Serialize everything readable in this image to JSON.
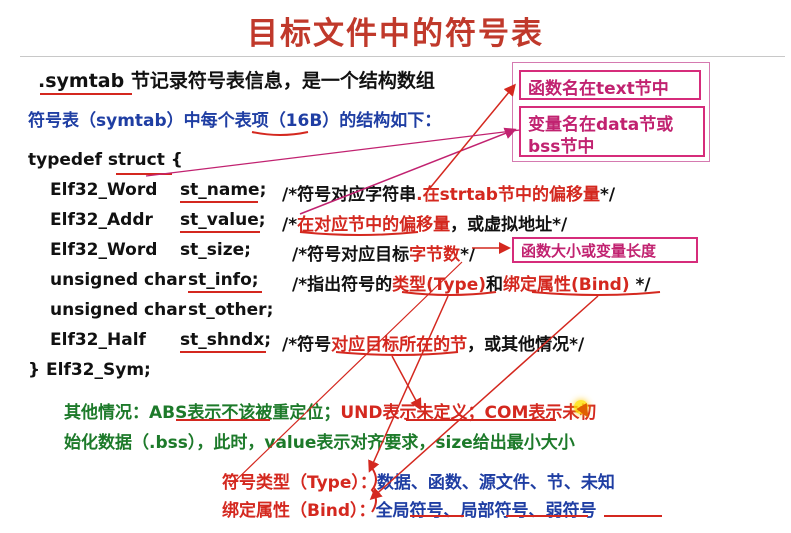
{
  "title": "目标文件中的符号表",
  "intro": {
    "symtab": ".symtab",
    "rest": " 节记录符号表信息，是一个结构数组"
  },
  "entry_desc": {
    "prefix": "符号表（symtab）中每",
    "mid": "个表项",
    "suffix": "（16B）的结构如下："
  },
  "notes": {
    "func_in_text": "函数名在text节中",
    "var_in_data": "变量名在data节或",
    "var_in_bss": "bss节中",
    "size_note": "函数大小或变量长度"
  },
  "code": {
    "typedef": "typedef ",
    "struct_kw": "struct",
    "brace_open": " {",
    "fields": [
      {
        "type": "Elf32_Word",
        "name": "st_name;",
        "comment_pre": "/*符号对应字符串",
        "comment_hl": ".在strtab节中的偏移量",
        "comment_post": "*/"
      },
      {
        "type": "Elf32_Addr",
        "name": "st_value;",
        "comment_pre": "/*",
        "comment_hl": "在对应节中的偏移量",
        "comment_post": "，或虚拟地址*/"
      },
      {
        "type": "Elf32_Word",
        "name": "st_size;",
        "comment_pre": "/*符号对应目标",
        "comment_hl": "字节数",
        "comment_post": "*/"
      },
      {
        "type": "unsigned char",
        "name": "st_info;",
        "comment_pre": "/*指出符号的",
        "comment_hl": "类型(Type)",
        "comment_mid": "和",
        "comment_hl2": "绑定属性(Bind)",
        "comment_post": " */"
      },
      {
        "type": "unsigned char",
        "name": "st_other;",
        "comment_pre": "",
        "comment_hl": "",
        "comment_post": ""
      },
      {
        "type": "Elf32_Half",
        "name": "st_shndx;",
        "comment_pre": "/*符号",
        "comment_hl": "对应目标所在的节",
        "comment_post": "，或其他情况*/"
      }
    ],
    "close": "} Elf32_Sym;"
  },
  "other": {
    "label": "其他情况：",
    "abs": "ABS表示不该被重定位；",
    "und": "UND表示未定义；",
    "com": "COM表示未初",
    "line2": "始化数据（.bss），此时，value表示对齐要求，size给出最小大小"
  },
  "type_line": {
    "label": "符号类型（Type）：",
    "values": "数据、函数、源文件、节、未知"
  },
  "bind_line": {
    "label": "绑定属性（Bind）：",
    "values": "全局符号、局部符号、弱符号"
  },
  "colors": {
    "title": "#c0392b",
    "red": "#d4281f",
    "blue": "#1f3ea3",
    "green": "#1d7a2a",
    "note_border": "#d62c7b"
  }
}
